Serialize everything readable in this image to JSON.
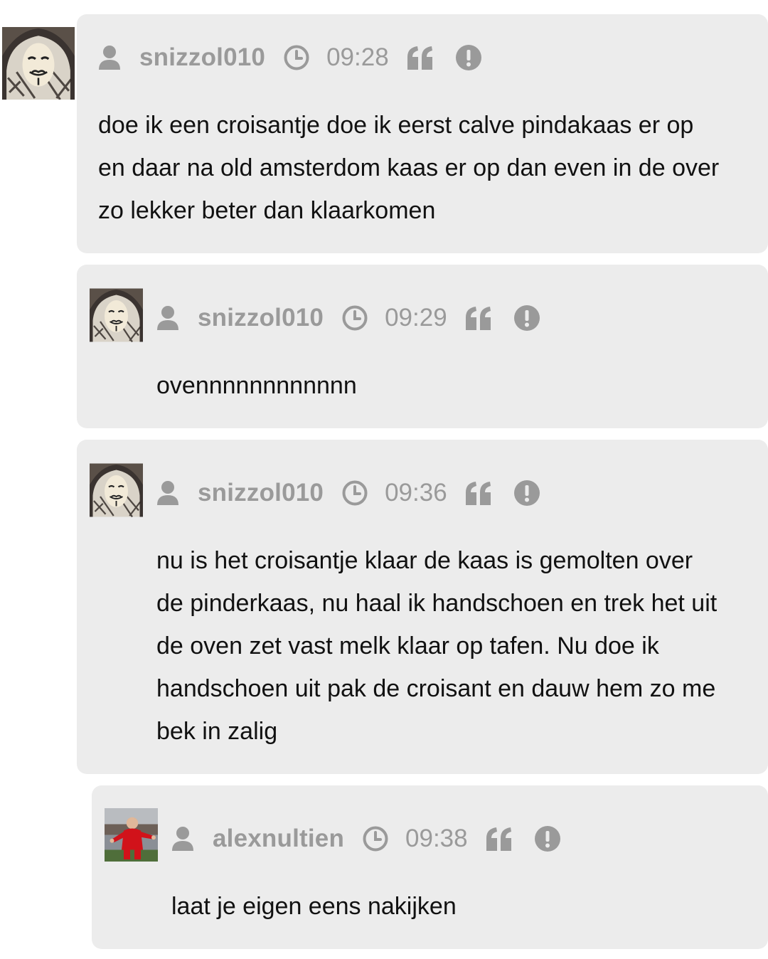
{
  "comments": [
    {
      "username": "snizzol010",
      "time": "09:28",
      "avatar_icon": "anonymous-mask-avatar-icon",
      "body_lines": [
        "doe ik een croisantje doe ik eerst calve pindakaas er op",
        "en daar na old amsterdom kaas er op dan even in de over",
        "zo lekker beter dan klaarkomen"
      ]
    },
    {
      "username": "snizzol010",
      "time": "09:29",
      "avatar_icon": "anonymous-mask-avatar-icon",
      "body_lines": [
        "ovennnnnnnnnnnn"
      ]
    },
    {
      "username": "snizzol010",
      "time": "09:36",
      "avatar_icon": "anonymous-mask-avatar-icon",
      "body_lines": [
        "nu is het croisantje klaar de kaas is gemolten over",
        "de pinderkaas, nu haal ik handschoen en trek het uit",
        "de oven zet vast melk klaar op tafen. Nu doe ik",
        "handschoen uit pak de croisant en dauw hem zo me",
        "bek in zalig"
      ]
    },
    {
      "username": "alexnultien",
      "time": "09:38",
      "avatar_icon": "football-player-avatar-icon",
      "body_lines": [
        "laat je eigen eens nakijken"
      ]
    }
  ],
  "icons": {
    "user": "user-icon",
    "clock": "clock-icon",
    "quote": "quote-icon",
    "report": "report-icon"
  },
  "colors": {
    "card_background": "#ececec",
    "meta_text": "#9a9a9a",
    "body_text": "#111111"
  }
}
